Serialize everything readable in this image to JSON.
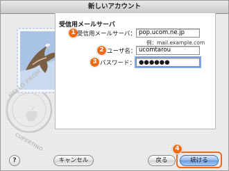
{
  "window": {
    "title": "新しいアカウント"
  },
  "section": {
    "title": "受信用メールサーバ"
  },
  "form": {
    "server": {
      "label": "受信用メールサーバ：",
      "value": "pop.ucom.ne.jp",
      "hint": "例：mail.example.com",
      "badge": "1"
    },
    "username": {
      "label": "ユーザ名：",
      "value": "ucomtarou",
      "badge": "2"
    },
    "password": {
      "label": "パスワード：",
      "value": "●●●●●●",
      "badge": "3"
    }
  },
  "buttons": {
    "help": "?",
    "cancel": "キャンセル",
    "back": "戻る",
    "continue": "続ける",
    "continue_badge": "4"
  },
  "stamp": {
    "text_top": "HELLO FROM",
    "text_bottom": "CUPERTINO"
  },
  "colors": {
    "accent_badge": "#ee6b16",
    "default_button": "#6a9be0"
  }
}
